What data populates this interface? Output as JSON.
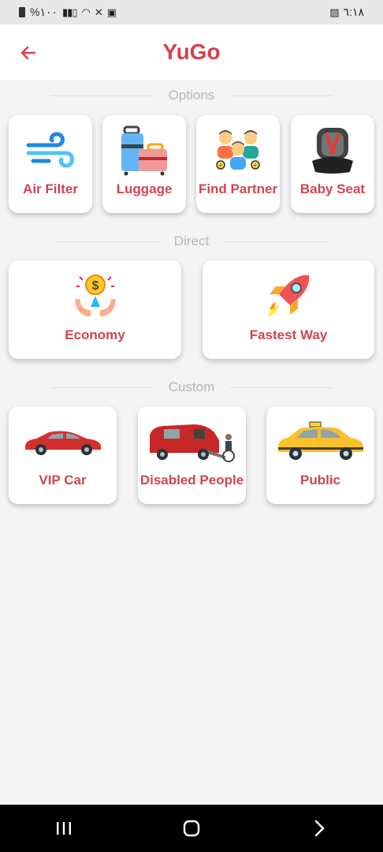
{
  "status": {
    "battery": "%١٠٠",
    "time": "٦:١٨"
  },
  "header": {
    "title": "YuGo"
  },
  "sections": {
    "options": "Options",
    "direct": "Direct",
    "custom": "Custom"
  },
  "options": [
    {
      "label": "Air Filter",
      "icon": "wind-icon"
    },
    {
      "label": "Luggage",
      "icon": "luggage-icon"
    },
    {
      "label": "Find Partner",
      "icon": "partners-icon"
    },
    {
      "label": "Baby Seat",
      "icon": "baby-seat-icon"
    }
  ],
  "direct": [
    {
      "label": "Economy",
      "icon": "money-hands-icon"
    },
    {
      "label": "Fastest Way",
      "icon": "rocket-icon"
    }
  ],
  "custom": [
    {
      "label": "VIP Car",
      "icon": "red-sedan-icon"
    },
    {
      "label": "Disabled People",
      "icon": "accessible-van-icon"
    },
    {
      "label": "Public",
      "icon": "taxi-icon"
    }
  ],
  "colors": {
    "accent": "#d8404a",
    "label": "#d14452",
    "section": "#b5b5b5"
  }
}
